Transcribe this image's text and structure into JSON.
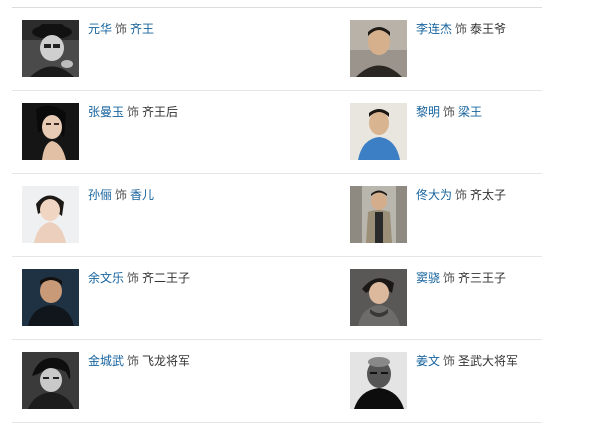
{
  "cast": [
    [
      {
        "actor": "元华",
        "separator": "饰",
        "role": "齐王",
        "role_linked": true
      },
      {
        "actor": "李连杰",
        "separator": "饰",
        "role": "泰王爷",
        "role_linked": false
      }
    ],
    [
      {
        "actor": "张曼玉",
        "separator": "饰",
        "role": "齐王后",
        "role_linked": false
      },
      {
        "actor": "黎明",
        "separator": "饰",
        "role": "梁王",
        "role_linked": true
      }
    ],
    [
      {
        "actor": "孙俪",
        "separator": "饰",
        "role": "香儿",
        "role_linked": true
      },
      {
        "actor": "佟大为",
        "separator": "饰",
        "role": "齐太子",
        "role_linked": false
      }
    ],
    [
      {
        "actor": "余文乐",
        "separator": "饰",
        "role": "齐二王子",
        "role_linked": false
      },
      {
        "actor": "窦骁",
        "separator": "饰",
        "role": "齐三王子",
        "role_linked": false
      }
    ],
    [
      {
        "actor": "金城武",
        "separator": "饰",
        "role": "飞龙将军",
        "role_linked": false
      },
      {
        "actor": "姜文",
        "separator": "饰",
        "role": "圣武大将军",
        "role_linked": false
      }
    ]
  ],
  "colors": {
    "link": "#16639e",
    "text": "#333333",
    "divider": "#e6e6e6"
  }
}
